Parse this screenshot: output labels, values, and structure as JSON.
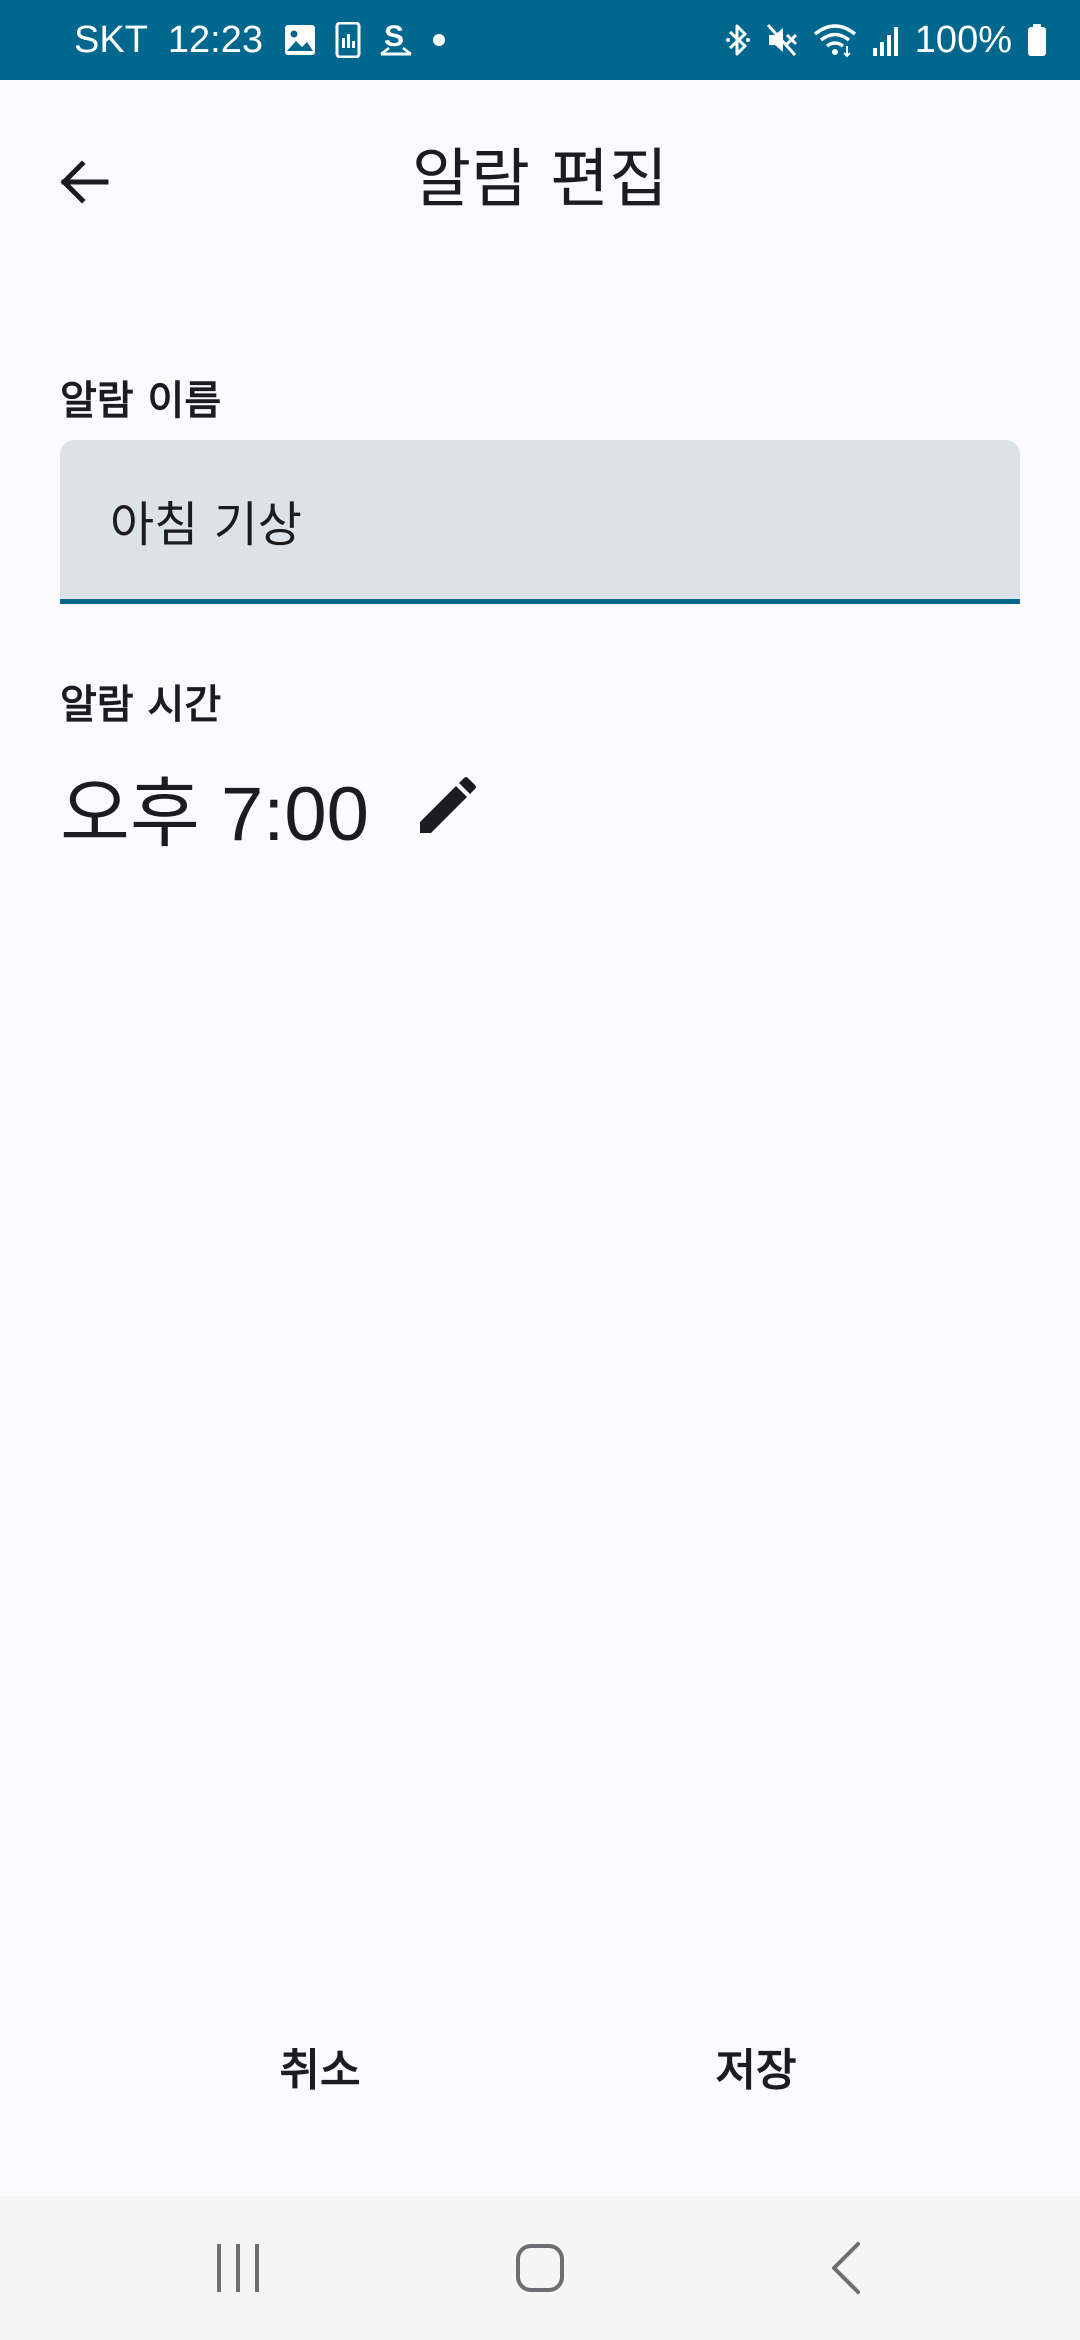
{
  "status_bar": {
    "carrier": "SKT",
    "time": "12:23",
    "battery": "100%",
    "background_color": "#00678f",
    "left_icons": [
      "gallery-icon",
      "phone-data-icon",
      "s-logo-icon",
      "notification-dot-icon"
    ],
    "right_icons": [
      "bluetooth-icon",
      "mute-icon",
      "wifi-icon",
      "signal-icon",
      "battery-icon"
    ]
  },
  "app_bar": {
    "title": "알람 편집"
  },
  "form": {
    "name_label": "알람 이름",
    "name_value": "아침 기상",
    "time_label": "알람 시간",
    "time_value": "오후 7:00"
  },
  "actions": {
    "cancel_label": "취소",
    "save_label": "저장"
  },
  "colors": {
    "accent": "#00678f",
    "field_background": "#dce3e8",
    "page_background": "#fbfbfe"
  }
}
